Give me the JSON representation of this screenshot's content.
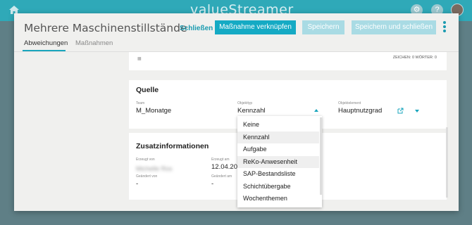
{
  "app": {
    "brand": "valueStreamer"
  },
  "header": {
    "help_glyph": "?"
  },
  "modal": {
    "title": "Mehrere Maschinenstillstände",
    "actions": {
      "close_label": "Schließen",
      "link_measure_label": "Maßnahme verknüpfen",
      "save_label": "Speichern",
      "save_close_label": "Speichern und schließen"
    },
    "tabs": [
      "Abweichungen",
      "Maßnahmen"
    ]
  },
  "editor": {
    "counts": "ZEICHEN: 0   WÖRTER: 0"
  },
  "source_section": {
    "title": "Quelle",
    "team_label": "Team",
    "team_value": "M_Monatge",
    "object_type_label": "Objekttyp",
    "object_type_value": "Kennzahl",
    "object_element_label": "Objektelement",
    "object_element_value": "Hauptnutzgrad"
  },
  "additional_section": {
    "title": "Zusatzinformationen",
    "created_by_label": "Erzeugt von",
    "created_by_value": "Michelle Ros",
    "created_on_label": "Erzeugt am",
    "created_on_value": "12.04.202",
    "changed_by_label": "Geändert von",
    "changed_by_value": "-",
    "changed_on_label": "Geändert am",
    "changed_on_value": "-"
  },
  "dropdown": {
    "options": [
      "Keine",
      "Kennzahl",
      "Aufgabe",
      "ReKo-Anwesenheit",
      "SAP-Bestandsliste",
      "Schichtübergabe",
      "Wochenthemen"
    ],
    "selected": "Kennzahl"
  },
  "colors": {
    "accent": "#15aac4",
    "disabled": "#a9dbe4",
    "appbar": "#2fa9b8"
  }
}
